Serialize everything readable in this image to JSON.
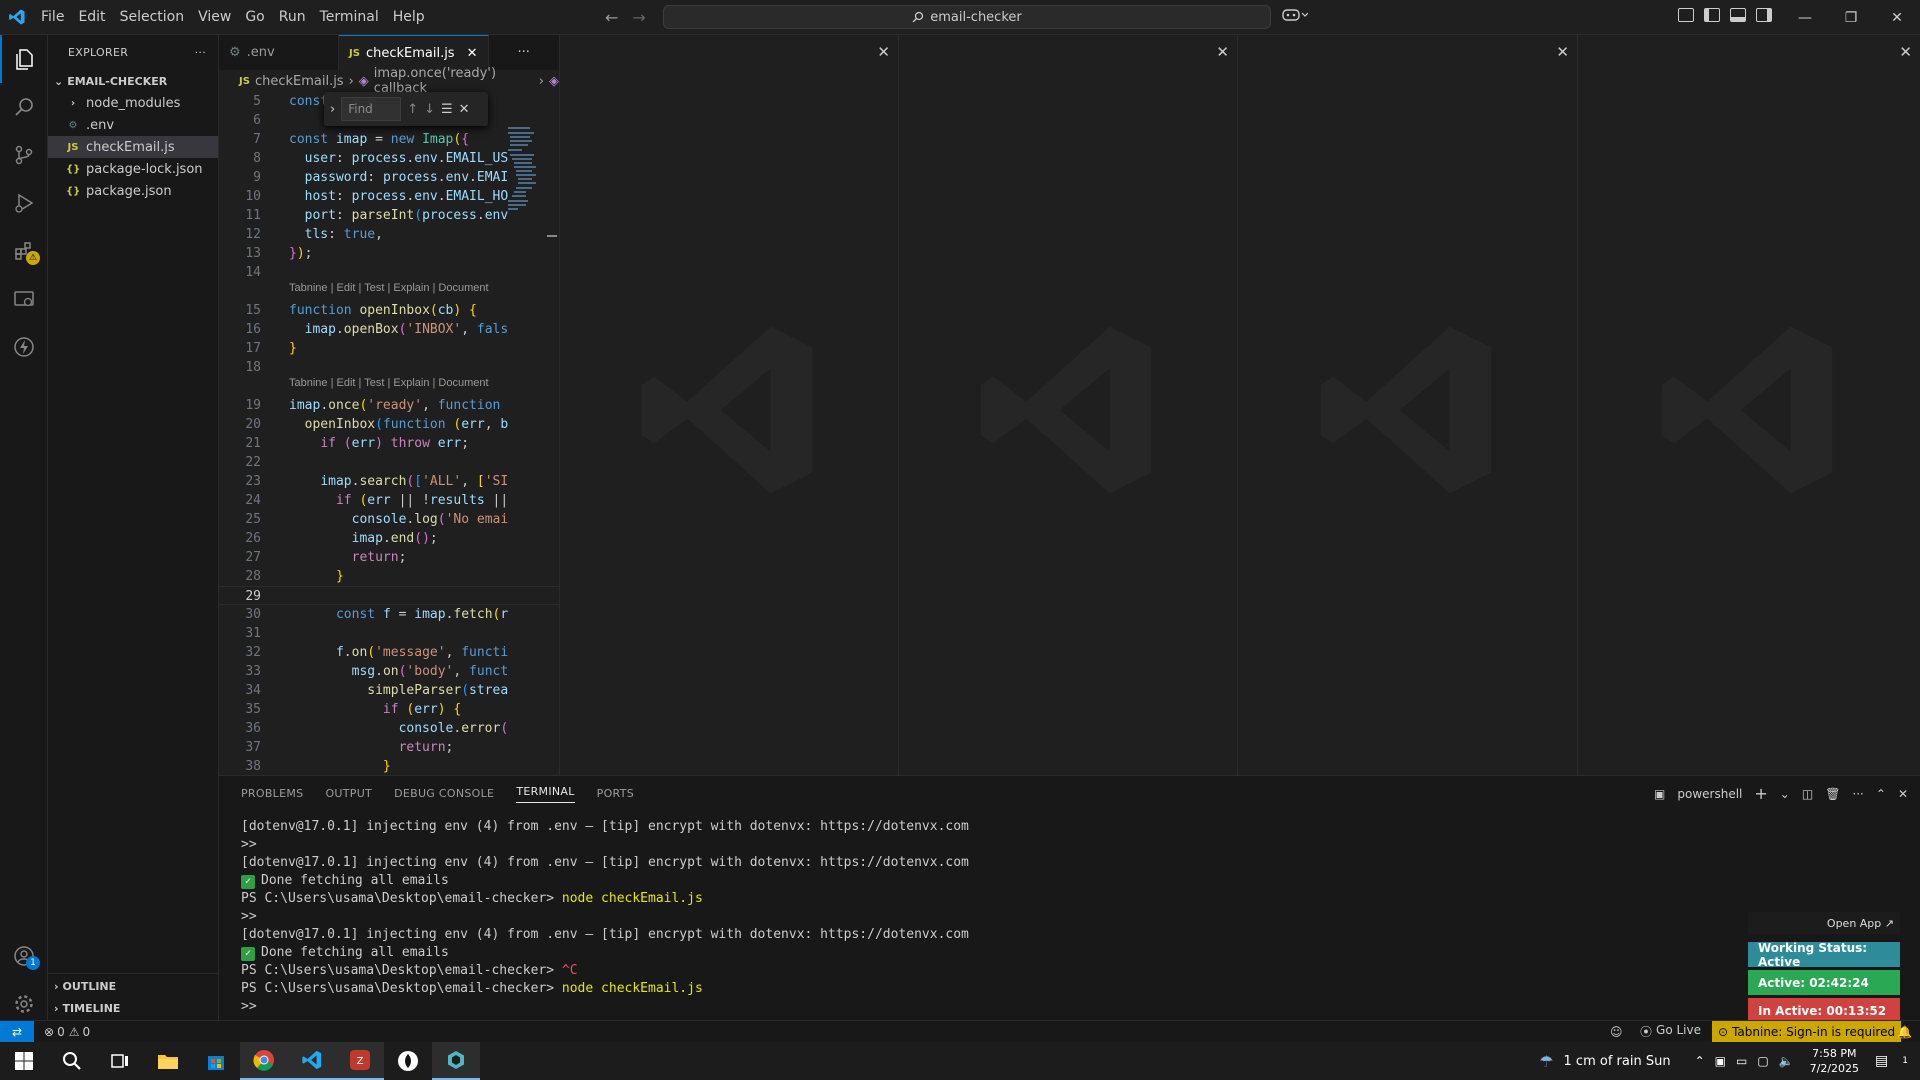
{
  "titlebar": {
    "menu": [
      "File",
      "Edit",
      "Selection",
      "View",
      "Go",
      "Run",
      "Terminal",
      "Help"
    ],
    "search": "email-checker",
    "copilot_icon": "copilot-icon",
    "window_controls": [
      "minimize",
      "restore",
      "close"
    ]
  },
  "activity_bar": {
    "items": [
      "explorer",
      "search",
      "source-control",
      "run-debug",
      "extensions",
      "remote-explorer",
      "lightning"
    ],
    "bottom": [
      "accounts",
      "settings"
    ],
    "accounts_badge": "1"
  },
  "sidebar": {
    "title": "EXPLORER",
    "folder": "EMAIL-CHECKER",
    "files": [
      {
        "name": "node_modules",
        "icon": ">"
      },
      {
        "name": ".env",
        "icon": "⚙"
      },
      {
        "name": "checkEmail.js",
        "icon": "JS"
      },
      {
        "name": "package-lock.json",
        "icon": "{}"
      },
      {
        "name": "package.json",
        "icon": "{}"
      }
    ],
    "outline": "OUTLINE",
    "timeline": "TIMELINE"
  },
  "tabs": [
    {
      "label": ".env",
      "icon": "⚙"
    },
    {
      "label": "checkEmail.js",
      "icon": "JS"
    }
  ],
  "breadcrumb": {
    "file": "checkEmail.js",
    "symbol": "imap.once('ready') callback"
  },
  "find": {
    "placeholder": "Find"
  },
  "codelens": "Tabnine | Edit | Test | Explain | Document",
  "line_numbers": [
    "5",
    "6",
    "7",
    "8",
    "9",
    "10",
    "11",
    "12",
    "13",
    "14",
    "15",
    "16",
    "17",
    "18",
    "19",
    "20",
    "21",
    "22",
    "23",
    "24",
    "25",
    "26",
    "27",
    "28",
    "29",
    "30",
    "31",
    "32",
    "33",
    "34",
    "35",
    "36",
    "37",
    "38"
  ],
  "panel": {
    "tabs": [
      "PROBLEMS",
      "OUTPUT",
      "DEBUG CONSOLE",
      "TERMINAL",
      "PORTS"
    ],
    "shell": "powershell",
    "lines": [
      "[dotenv@17.0.1] injecting env (4) from .env – [tip] encrypt with dotenvx: https://dotenvx.com",
      ">>",
      "[dotenv@17.0.1] injecting env (4) from .env – [tip] encrypt with dotenvx: https://dotenvx.com",
      "Done fetching all emails",
      "PS C:\\Users\\usama\\Desktop\\email-checker> ",
      ">>",
      "[dotenv@17.0.1] injecting env (4) from .env – [tip] encrypt with dotenvx: https://dotenvx.com",
      "Done fetching all emails",
      "PS C:\\Users\\usama\\Desktop\\email-checker> ",
      "PS C:\\Users\\usama\\Desktop\\email-checker> ",
      ">>"
    ],
    "cmd_node": "node checkEmail.js",
    "cmd_ctrlc": "^C"
  },
  "widget": {
    "open_app": "Open App ↗",
    "working": "Working Status: Active",
    "active": "Active: 02:42:24",
    "inactive": "In Active: 00:13:52"
  },
  "statusbar": {
    "errors": "0",
    "warnings": "0",
    "go_live": "Go Live",
    "tabnine": "Tabnine: Sign-in is required"
  },
  "taskbar": {
    "weather": "1 cm of rain Sun",
    "time": "7:58 PM",
    "date": "7/2/2025",
    "notif": "1"
  }
}
